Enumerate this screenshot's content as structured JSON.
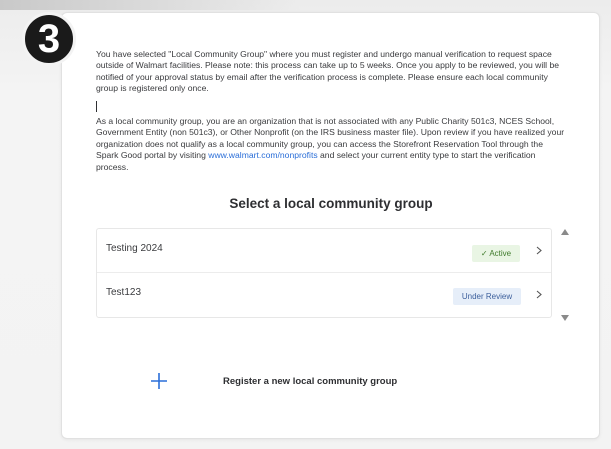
{
  "step": {
    "number": "3"
  },
  "intro": {
    "paragraph1": "You have selected \"Local Community Group\" where you must register and undergo manual verification to request space outside of Walmart facilities. Please note: this process can take up to 5 weeks. Once you apply to be reviewed, you will be notified of your approval status by email after the verification process is complete. Please ensure each local community group is registered only once.",
    "paragraph2_before_link": "As a local community group, you are an organization that is not associated with any Public Charity 501c3, NCES School, Government Entity (non 501c3), or Other Nonprofit (on the IRS business master file). Upon review if you have realized your organization does not qualify as a local community group, you can access the Storefront Reservation Tool through the Spark Good portal by visiting ",
    "link_text": "www.walmart.com/nonprofits",
    "paragraph2_after_link": "  and select your current entity type to start the verification process."
  },
  "section": {
    "title": "Select a local community group"
  },
  "groups": [
    {
      "name": "Testing 2024",
      "status": "✓ Active",
      "status_kind": "active"
    },
    {
      "name": "Test123",
      "status": "Under Review",
      "status_kind": "review"
    }
  ],
  "add_group": {
    "label": "Register a new local community group",
    "icon": "plus-icon"
  },
  "colors": {
    "link": "#2a6ed8",
    "active_bg": "#e9f5e4",
    "active_text": "#3f7b2c",
    "review_bg": "#e6eef9",
    "review_text": "#3c5f9c",
    "plus": "#2a6ed8"
  }
}
